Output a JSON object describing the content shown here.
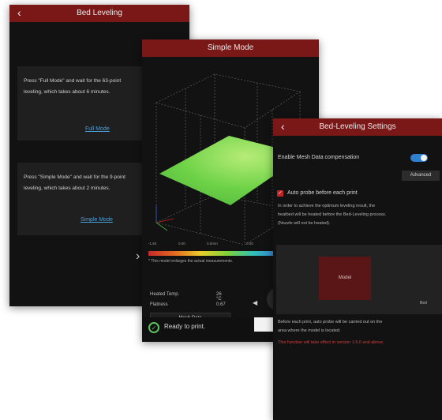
{
  "bed_leveling": {
    "title": "Bed Leveling",
    "back_glyph": "‹",
    "full_mode": {
      "description": [
        "Press \"Full Mode\" and wait for the 63-point",
        "leveling, which takes about 6 minutes."
      ],
      "button": "Full Mode"
    },
    "simple_mode": {
      "description": [
        "Press \"Simple Mode\" and wait for the 9-point",
        "leveling, which takes about 2 minutes."
      ],
      "button": "Simple Mode"
    },
    "right_arrow_glyph": "›"
  },
  "simple_mode_screen": {
    "title": "Simple Mode",
    "colorbar_ticks": [
      "-1.50",
      "0.00",
      "0.0mm",
      "0.00",
      "± 1.0"
    ],
    "colorbar_note": "* This model enlarges the actual measurements.",
    "stats": [
      {
        "label": "Heated Temp.",
        "value": "26 °C"
      },
      {
        "label": "Flatness",
        "value": "0.67"
      }
    ],
    "mesh_button": "Mesh Data",
    "status": "Ready to print.",
    "prev_glyph": "◀",
    "ready_glyph": "✓"
  },
  "settings": {
    "title": "Bed-Leveling Settings",
    "back_glyph": "‹",
    "mesh_compensation_label": "Enable Mesh Data compensation",
    "mesh_compensation_on": true,
    "advanced_button": "Advanced",
    "auto_probe_label": "Auto probe before each print",
    "auto_probe_checked": true,
    "check_glyph": "✓",
    "auto_probe_help": [
      "In order to achieve the optimum leveling result, the",
      "heatbed will be heated before the Bed-Leveling process.",
      "(Nozzle will not be heated)."
    ],
    "model_label": "Model",
    "bed_label": "Bed",
    "probe_note": [
      "Before each print, auto probe will be carried out on the",
      "area where the model is located."
    ],
    "warning": "This function will take effect in version 1.5.0 and above."
  },
  "colors": {
    "header_red": "#7a1717",
    "link_blue": "#4aa0d8",
    "toggle_blue": "#2f7fd0",
    "ok_green": "#5cc25c",
    "warn_red": "#d23c3c"
  }
}
